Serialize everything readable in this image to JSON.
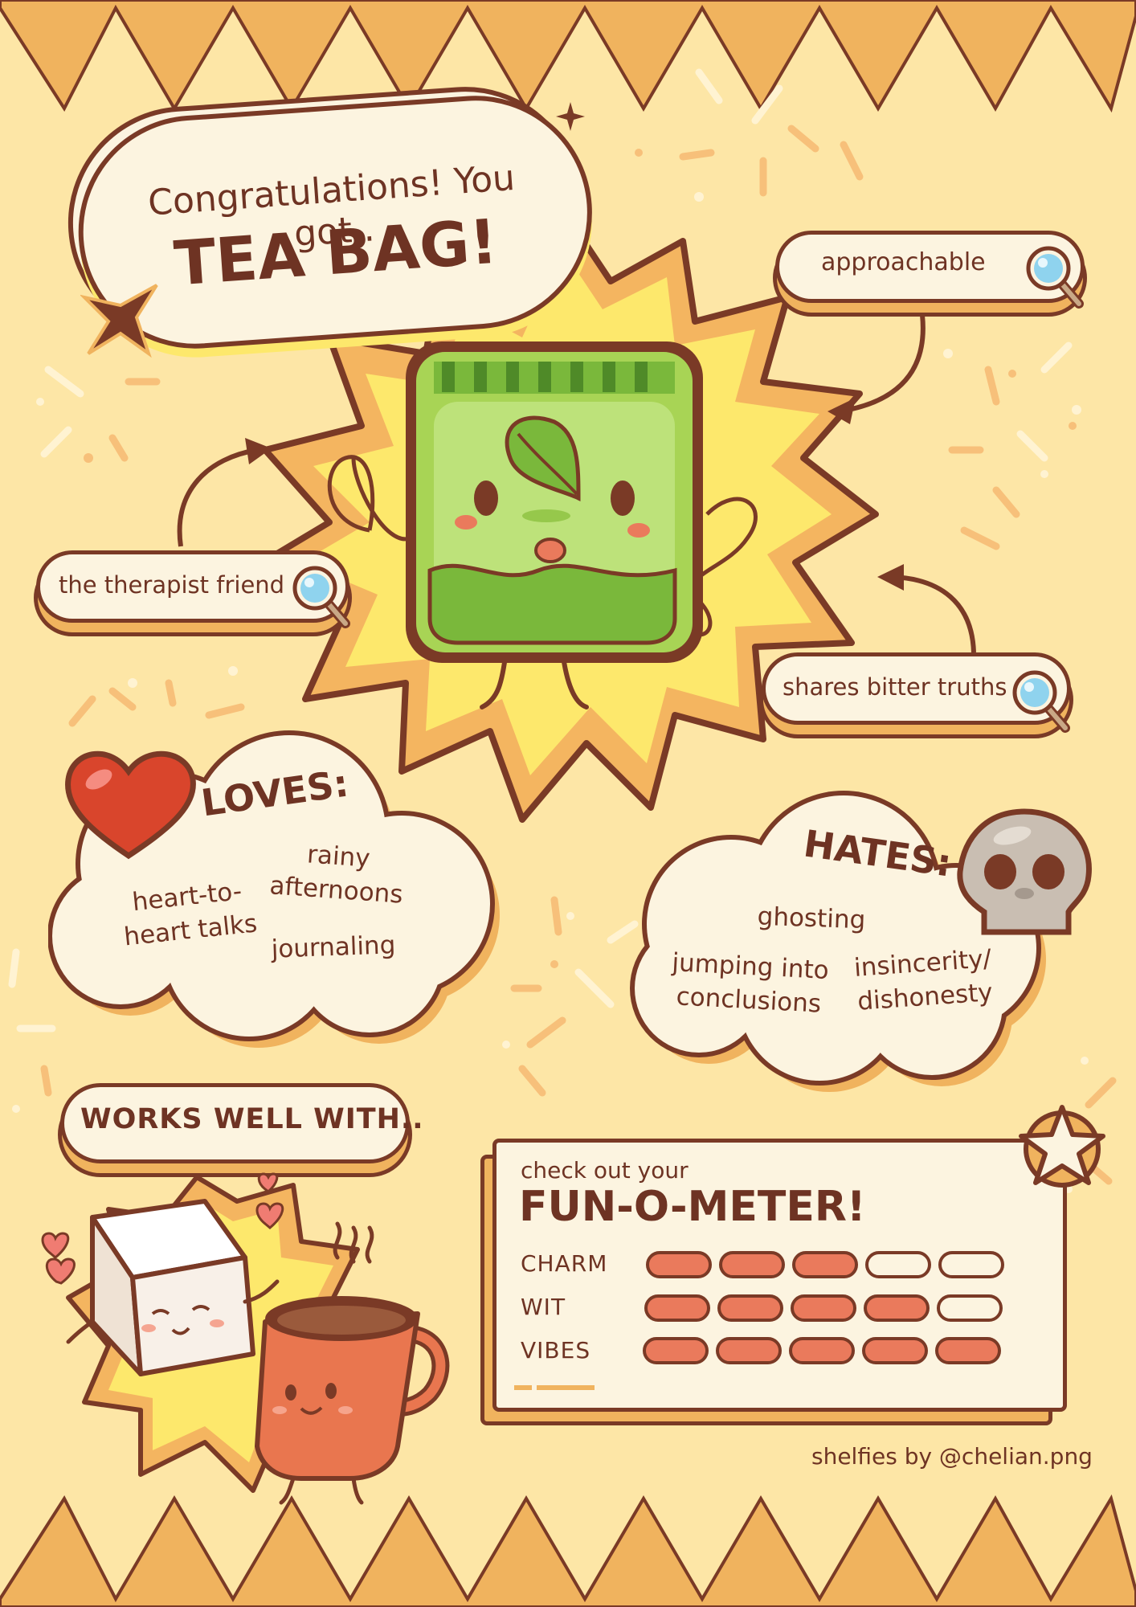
{
  "header": {
    "congrats": "Congratulations! You got..",
    "result": "TEA BAG!"
  },
  "traits": [
    {
      "label": "approachable"
    },
    {
      "label": "the therapist friend"
    },
    {
      "label": "shares bitter truths"
    }
  ],
  "loves": {
    "title": "LOVES:",
    "items": [
      "heart-to-\nheart talks",
      "rainy\nafternoons",
      "journaling"
    ]
  },
  "hates": {
    "title": "HATES:",
    "items": [
      "ghosting",
      "jumping into\nconclusions",
      "insincerity/\ndishonesty"
    ]
  },
  "works_with": {
    "title": "WORKS WELL WITH.."
  },
  "fun_meter": {
    "subtitle": "check out your",
    "title": "FUN-O-METER!",
    "max": 5,
    "rows": [
      {
        "label": "CHARM",
        "value": 3
      },
      {
        "label": "WIT",
        "value": 4
      },
      {
        "label": "VIBES",
        "value": 5
      }
    ]
  },
  "credit": "shelfies by @chelian.png",
  "icons": [
    "magnifier-icon",
    "heart-icon",
    "skull-icon",
    "star-icon",
    "leaf-icon"
  ],
  "colors": {
    "background": "#fde6a6",
    "accent_orange": "#f0b35e",
    "outline_brown": "#7a3a26",
    "meter_fill": "#ea7a5c",
    "card": "#fcf4e0",
    "tea_green": "#a8d455"
  }
}
